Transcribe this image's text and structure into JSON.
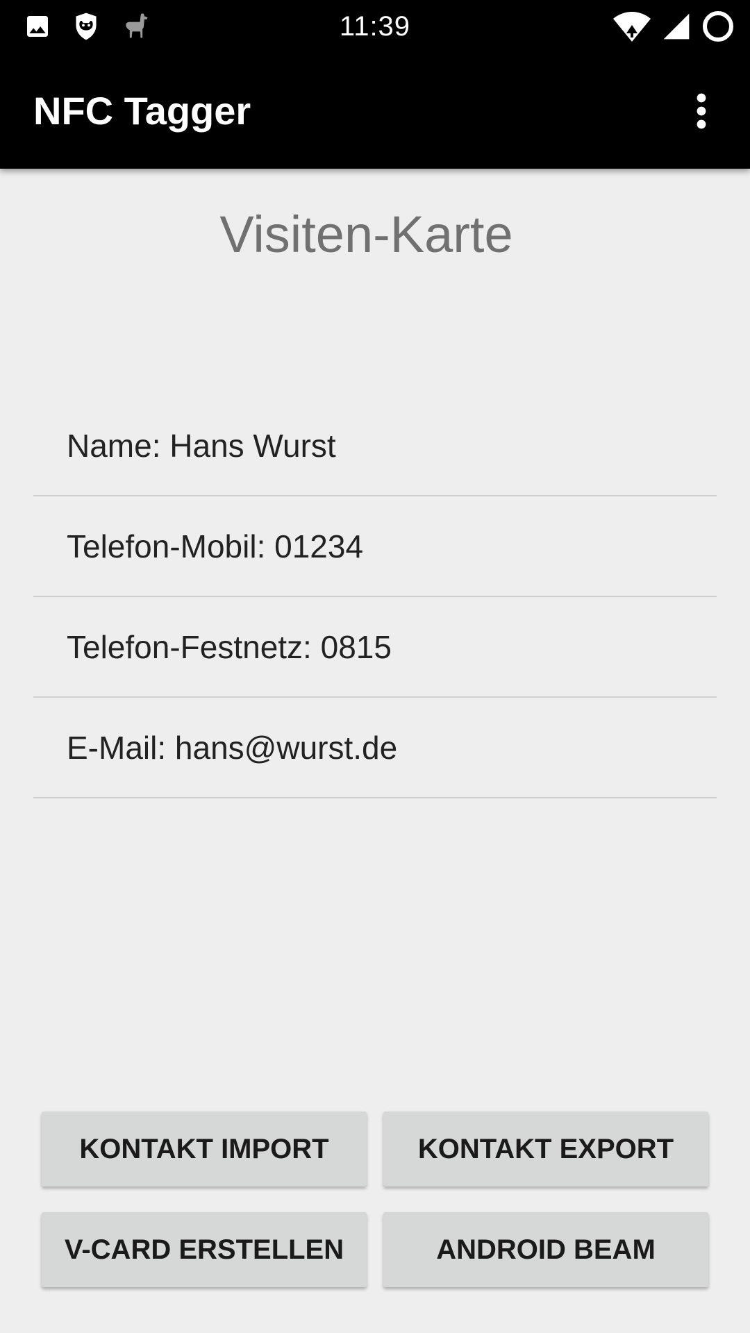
{
  "status_bar": {
    "time": "11:39",
    "left_icons": [
      "image-icon",
      "cat-mask-icon",
      "llama-icon"
    ],
    "right_icons": [
      "wifi-icon",
      "cell-signal-icon",
      "battery-circle-icon"
    ]
  },
  "app_bar": {
    "title": "NFC Tagger",
    "menu_icon": "overflow-menu-icon"
  },
  "main": {
    "heading": "Visiten-Karte",
    "fields": [
      {
        "label": "Name: Hans Wurst"
      },
      {
        "label": "Telefon-Mobil: 01234"
      },
      {
        "label": "Telefon-Festnetz: 0815"
      },
      {
        "label": "E-Mail: hans@wurst.de"
      }
    ]
  },
  "buttons": {
    "import": "KONTAKT IMPORT",
    "export": "KONTAKT EXPORT",
    "vcard": "V-CARD ERSTELLEN",
    "beam": "ANDROID BEAM"
  },
  "colors": {
    "status_bar": "#000000",
    "app_bar": "#000000",
    "background": "#eeeeee",
    "heading_text": "#707070",
    "button_bg": "#d6d7d7"
  }
}
